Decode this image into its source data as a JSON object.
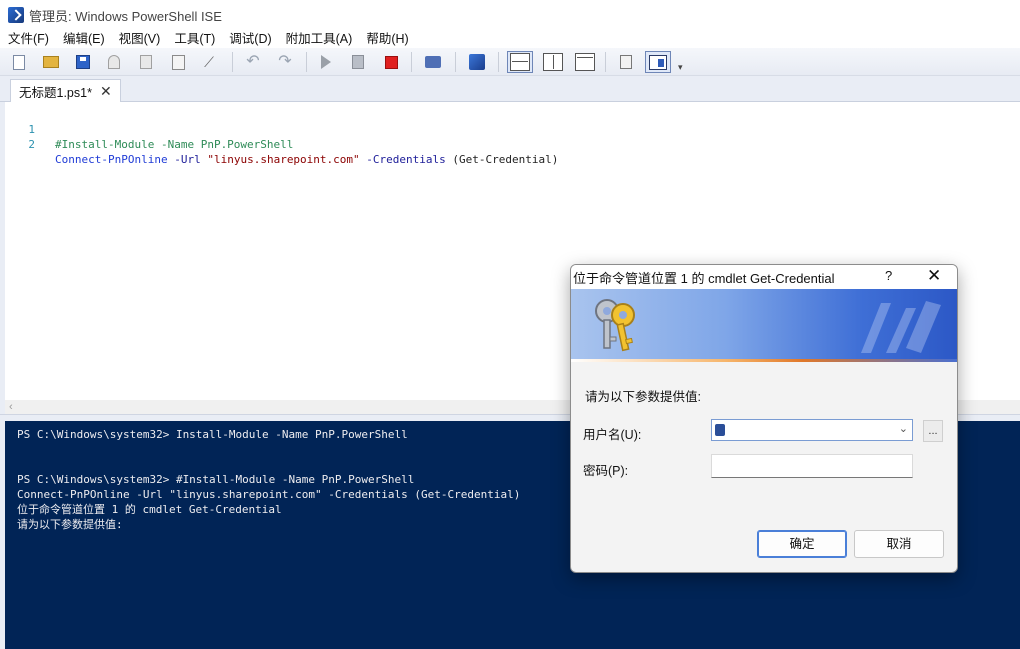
{
  "window": {
    "title": "管理员: Windows PowerShell ISE"
  },
  "menu": [
    "文件(F)",
    "编辑(E)",
    "视图(V)",
    "工具(T)",
    "调试(D)",
    "附加工具(A)",
    "帮助(H)"
  ],
  "toolbar": {
    "icons": [
      "new-file-icon",
      "open-file-icon",
      "save-icon",
      "cut-icon",
      "copy-icon",
      "paste-icon",
      "clear-console-icon",
      "undo-icon",
      "redo-icon",
      "run-script-icon",
      "run-selection-icon",
      "stop-icon",
      "remote-powershell-icon",
      "powershell-console-icon",
      "show-script-top-icon",
      "show-script-right-icon",
      "show-script-maximized-icon",
      "show-script-pane-icon",
      "show-command-addon-icon"
    ]
  },
  "tabs": [
    {
      "label": "无标题1.ps1*",
      "close": "✕"
    }
  ],
  "editor": {
    "lines": [
      {
        "n": "1",
        "text": "#Install-Module -Name PnP.PowerShell"
      },
      {
        "n": "2",
        "cmd": "Connect-PnPOnline",
        "p1": " -Url ",
        "str": "\"linyus.sharepoint.com\"",
        "p2": " -Credentials ",
        "rest": "(Get-Credential)"
      }
    ]
  },
  "console": {
    "lines": [
      "PS C:\\Windows\\system32> Install-Module -Name PnP.PowerShell",
      "",
      "",
      "PS C:\\Windows\\system32> #Install-Module -Name PnP.PowerShell",
      "Connect-PnPOnline -Url \"linyus.sharepoint.com\" -Credentials (Get-Credential)",
      "位于命令管道位置 1 的 cmdlet Get-Credential",
      "请为以下参数提供值:"
    ]
  },
  "dialog": {
    "title": "位于命令管道位置 1 的 cmdlet Get-Credential",
    "help": "?",
    "close": "✕",
    "prompt": "请为以下参数提供值:",
    "username_label": "用户名(U):",
    "username_value": "",
    "password_label": "密码(P):",
    "password_value": "",
    "ellipsis": "...",
    "ok": "确定",
    "cancel": "取消"
  }
}
